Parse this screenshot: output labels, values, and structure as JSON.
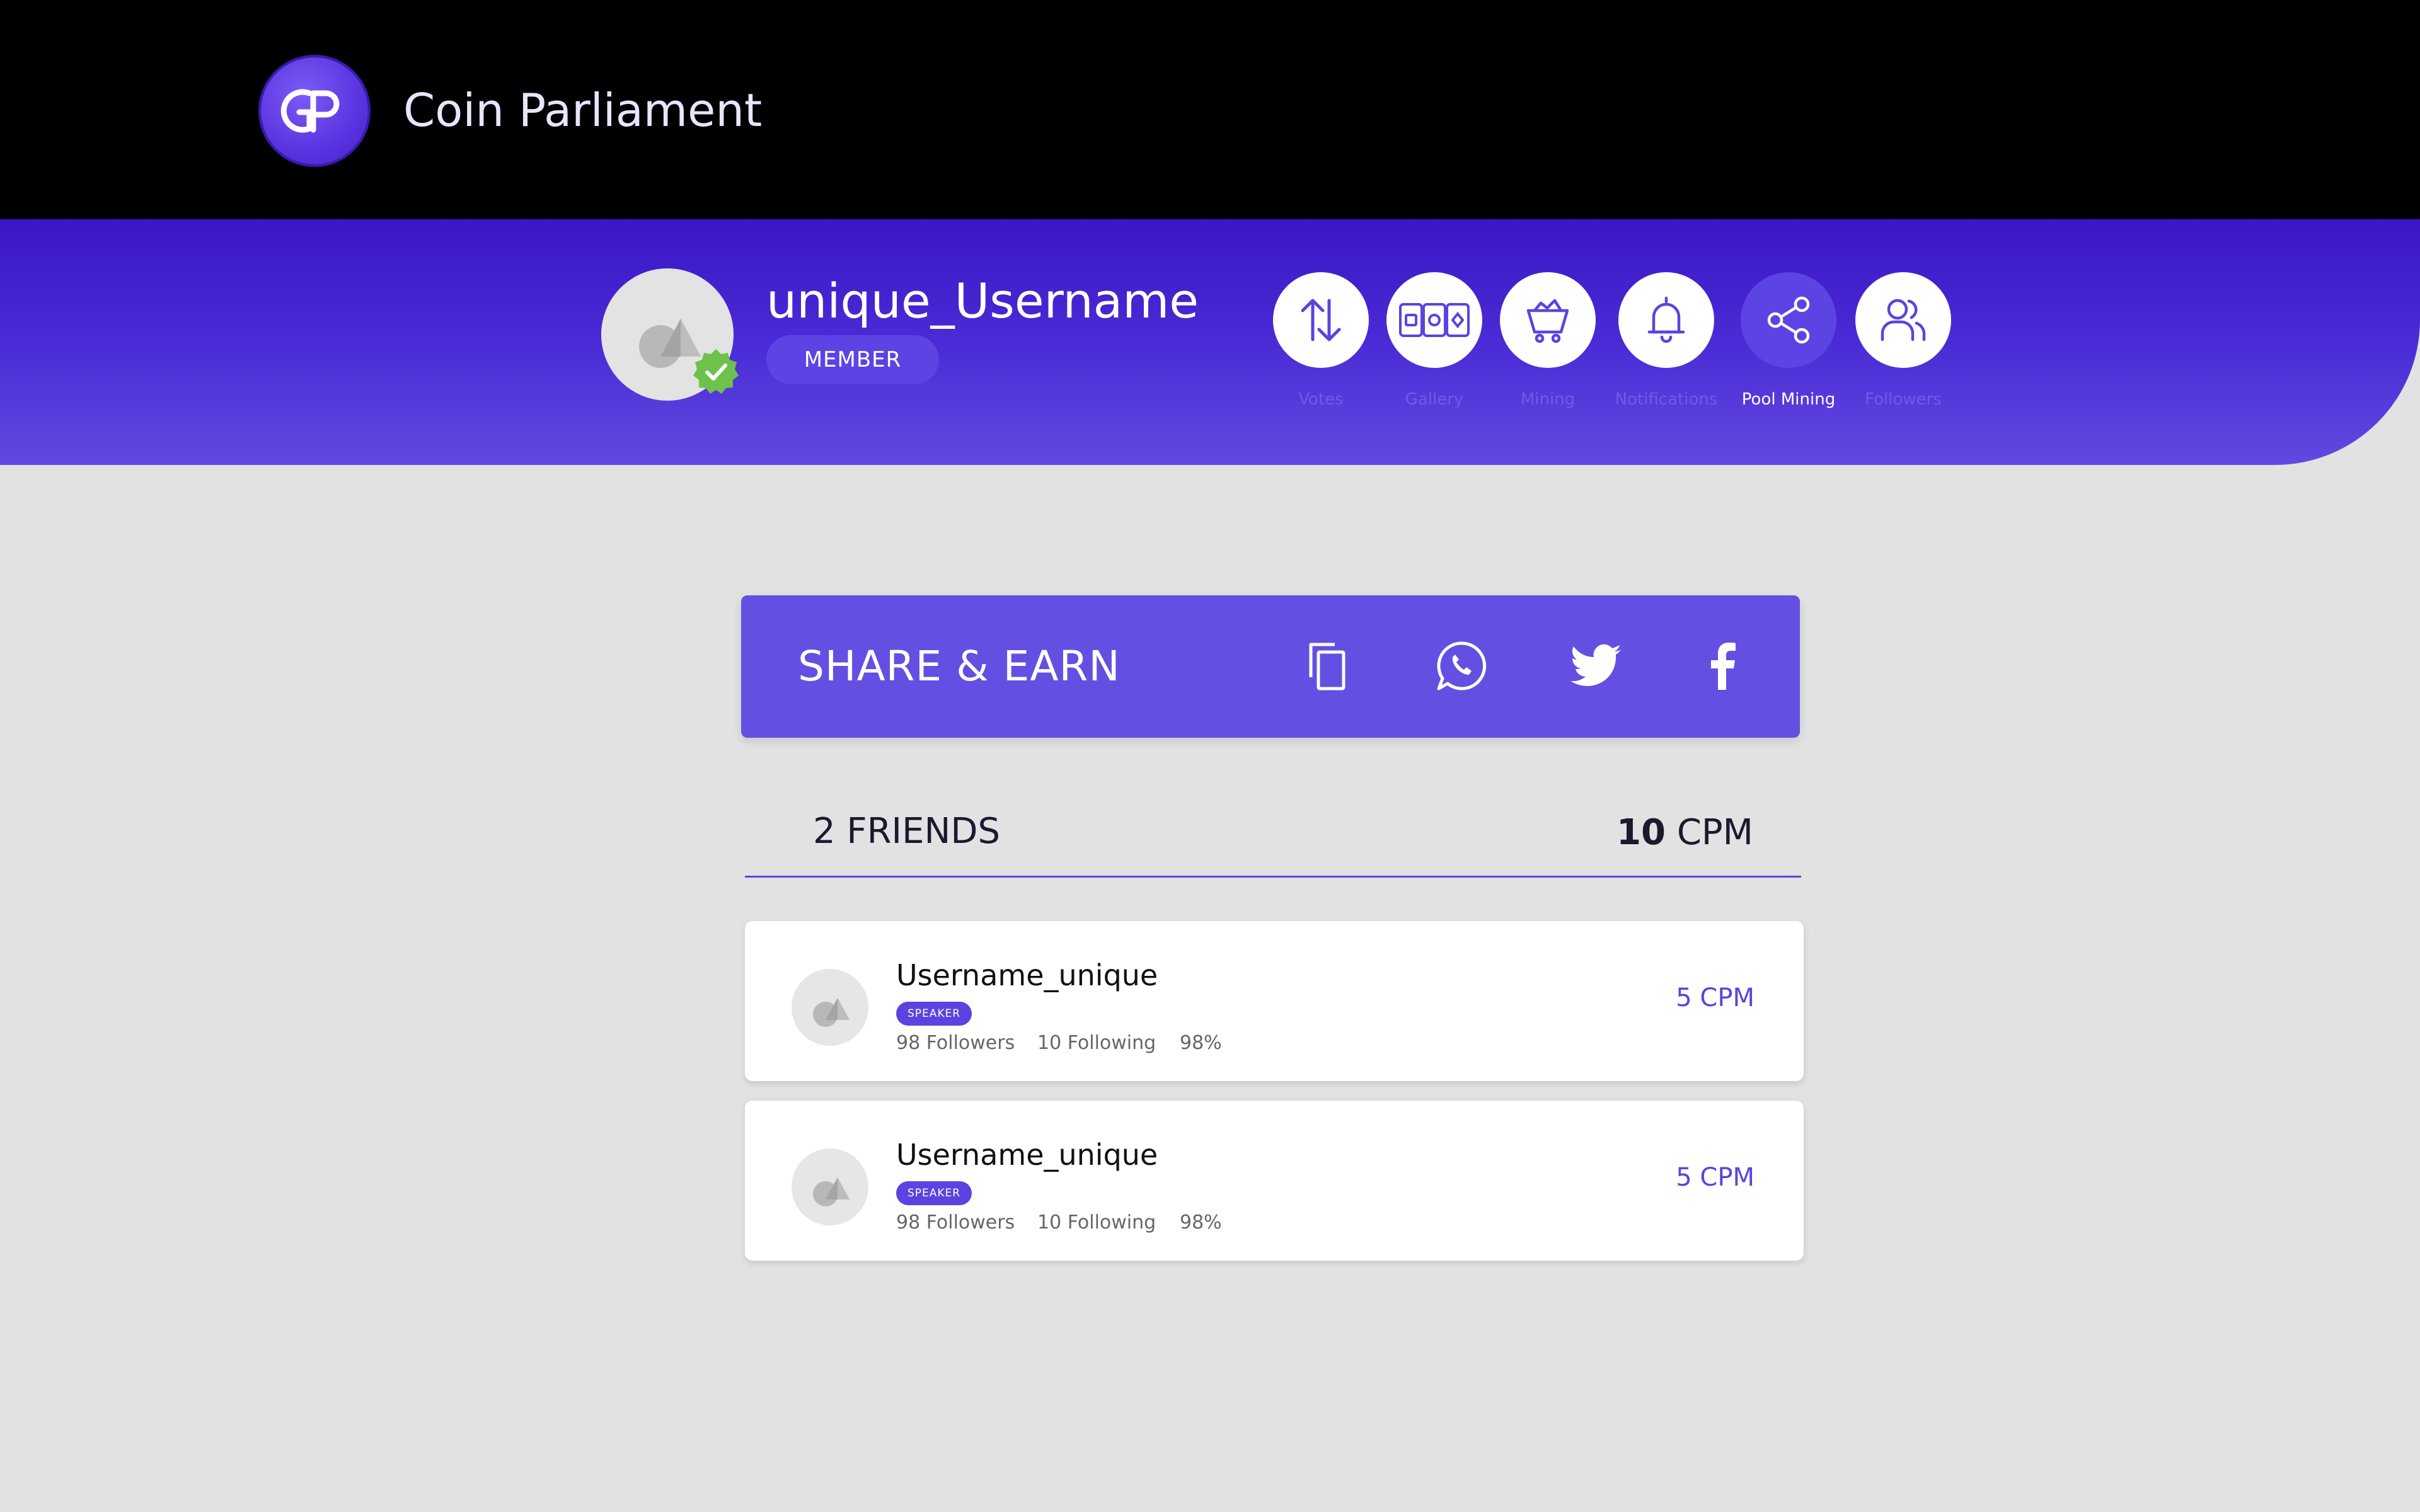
{
  "app": {
    "logo_text": "CP",
    "title": "Coin Parliament"
  },
  "profile": {
    "username": "unique_Username",
    "badge": "MEMBER",
    "verified": true
  },
  "nav": {
    "items": [
      {
        "label": "Votes",
        "icon": "arrows-up-down-icon",
        "active": false
      },
      {
        "label": "Gallery",
        "icon": "cards-icon",
        "active": false
      },
      {
        "label": "Mining",
        "icon": "mining-cart-icon",
        "active": false
      },
      {
        "label": "Notifications",
        "icon": "bell-icon",
        "active": false
      },
      {
        "label": "Pool Mining",
        "icon": "share-icon",
        "active": true
      },
      {
        "label": "Followers",
        "icon": "users-icon",
        "active": false
      }
    ]
  },
  "share": {
    "title": "SHARE & EARN",
    "actions": [
      "copy-icon",
      "whatsapp-icon",
      "twitter-icon",
      "facebook-icon"
    ]
  },
  "friends": {
    "count_label": "2 FRIENDS",
    "total_cpm_value": "10",
    "total_cpm_unit": "CPM",
    "list": [
      {
        "name": "Username_unique",
        "badge": "SPEAKER",
        "followers": "98 Followers",
        "following": "10 Following",
        "percent": "98%",
        "cpm": "5 CPM"
      },
      {
        "name": "Username_unique",
        "badge": "SPEAKER",
        "followers": "98 Followers",
        "following": "10 Following",
        "percent": "98%",
        "cpm": "5 CPM"
      }
    ]
  },
  "colors": {
    "accent": "#5a43e0",
    "band_top": "#3b16c4",
    "band_bottom": "#6249e0",
    "verified_green": "#6cc24a"
  }
}
